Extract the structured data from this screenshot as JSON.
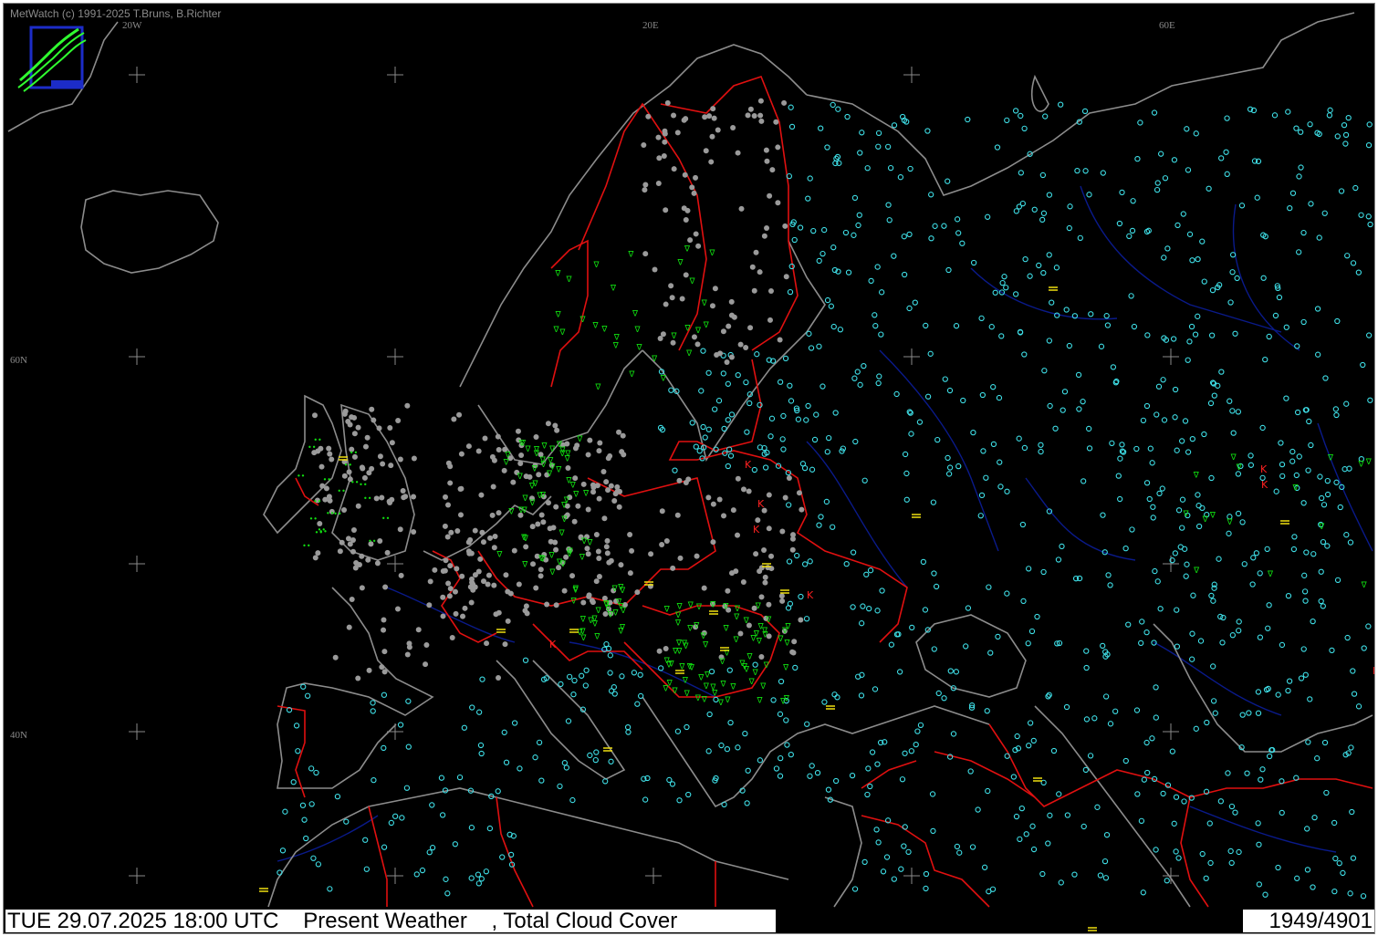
{
  "app": {
    "credit": "MetWatch  (c) 1991-2025 T.Bruns, B.Richter",
    "logo_icon": "metwatch-logo"
  },
  "grid": {
    "lon_labels": [
      "20W",
      "20E",
      "60E"
    ],
    "lat_labels": [
      "60N",
      "40N"
    ]
  },
  "status": {
    "datetime": "TUE 29.07.2025 18:00 UTC",
    "product": "Present Weather",
    "separator": ",",
    "overlay": "Total Cloud Cover",
    "counter": "1949/4901"
  },
  "colors": {
    "background": "#000000",
    "coastline": "#8c8c8c",
    "border": "#e01010",
    "river": "#0a1a8a",
    "clear_sky": "#3fe0e8",
    "overcast": "#9a9a9a",
    "rain": "#10e010",
    "fog": "#f0e010",
    "thunder": "#ff2020"
  },
  "symbol_icons": [
    "clear-sky-circle",
    "overcast-dot",
    "rain-shower-icon",
    "drizzle-icon",
    "fog-lines-icon",
    "thunderstorm-icon"
  ]
}
